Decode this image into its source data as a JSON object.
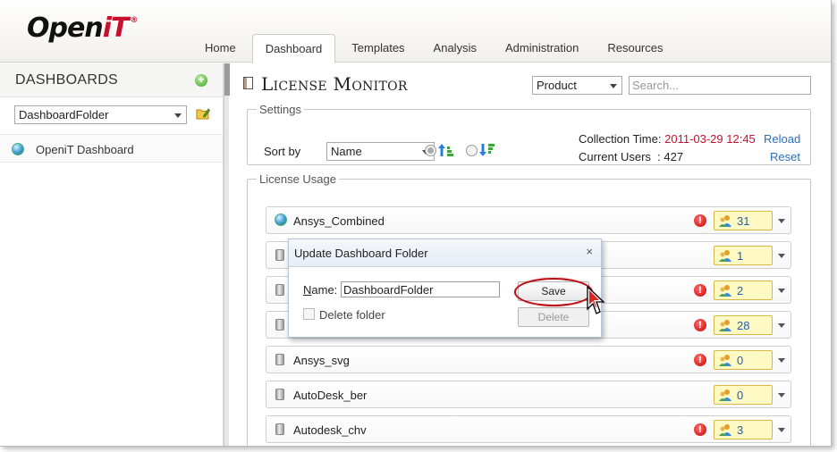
{
  "logo": {
    "open": "Open",
    "it": "iT",
    "reg": "®"
  },
  "nav": {
    "tabs": [
      {
        "label": "Home",
        "active": false
      },
      {
        "label": "Dashboard",
        "active": true
      },
      {
        "label": "Templates",
        "active": false
      },
      {
        "label": "Analysis",
        "active": false
      },
      {
        "label": "Administration",
        "active": false
      },
      {
        "label": "Resources",
        "active": false
      }
    ]
  },
  "sidebar": {
    "title": "DASHBOARDS",
    "folder_select": "DashboardFolder",
    "items": [
      {
        "label": "OpeniT Dashboard"
      }
    ]
  },
  "main": {
    "title": "License Monitor",
    "product_select": "Product",
    "search_placeholder": "Search...",
    "settings": {
      "legend": "Settings",
      "sort_label": "Sort by",
      "sort_value": "Name",
      "collection_label": "Collection Time:",
      "collection_value": "2011-03-29 12:45",
      "users_label": "Current Users",
      "users_sep": ":",
      "users_value": "427",
      "reload": "Reload",
      "reset": "Reset"
    },
    "usage": {
      "legend": "License Usage",
      "rows": [
        {
          "name": "Ansys_Combined",
          "count": "31",
          "alert": true,
          "globe": true
        },
        {
          "name": "",
          "count": "1",
          "alert": false,
          "globe": false
        },
        {
          "name": "",
          "count": "2",
          "alert": true,
          "globe": false
        },
        {
          "name": "",
          "count": "28",
          "alert": true,
          "globe": false
        },
        {
          "name": "Ansys_svg",
          "count": "0",
          "alert": true,
          "globe": false
        },
        {
          "name": "AutoDesk_ber",
          "count": "0",
          "alert": false,
          "globe": false
        },
        {
          "name": "Autodesk_chv",
          "count": "3",
          "alert": true,
          "globe": false
        }
      ]
    }
  },
  "dialog": {
    "title": "Update Dashboard Folder",
    "close": "×",
    "name_label_u": "N",
    "name_label_rest": "ame:",
    "name_value": "DashboardFolder",
    "delete_label": "Delete folder",
    "save": "Save",
    "delete": "Delete"
  },
  "colors": {
    "accent_red": "#c8102e",
    "link": "#2a6fba",
    "badge_bg": "#fff9c4"
  }
}
